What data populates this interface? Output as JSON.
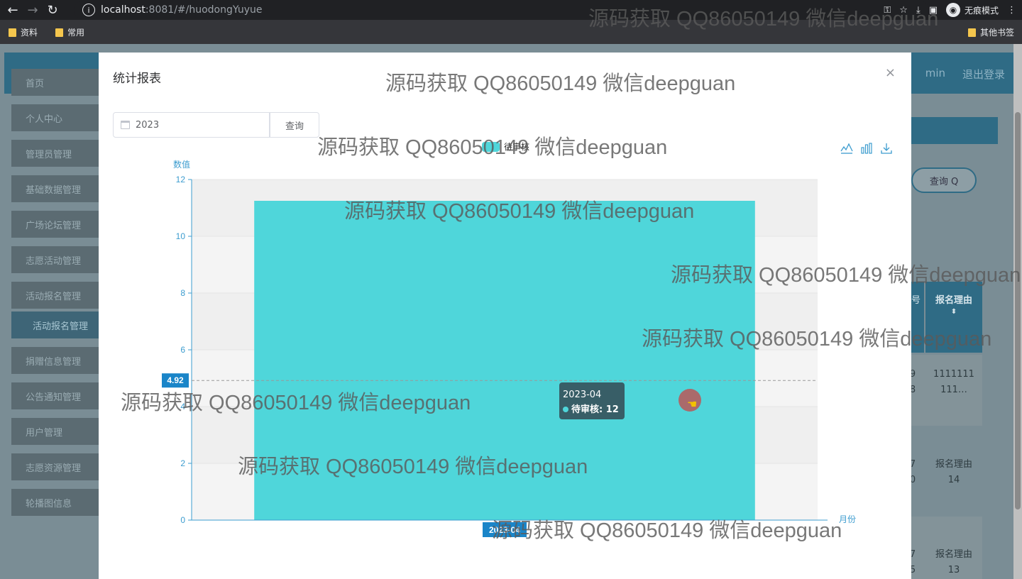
{
  "browser": {
    "url_host": "localhost",
    "url_path": ":8081/#/huodongYuyue",
    "incognito_label": "无痕模式",
    "bookmarks": [
      "资料",
      "常用"
    ],
    "other_bookmarks": "其他书签"
  },
  "app": {
    "header_user": "min",
    "header_logout": "退出登录",
    "sidebar": [
      "首页",
      "个人中心",
      "管理员管理",
      "基础数据管理",
      "广场论坛管理",
      "志愿活动管理",
      "活动报名管理"
    ],
    "sidebar_sub": "活动报名管理",
    "sidebar_rest": [
      "捐赠信息管理",
      "公告通知管理",
      "用户管理",
      "志愿资源管理",
      "轮播图信息"
    ],
    "bg_query_label": "查询 Q",
    "bg_th_left": "号",
    "bg_th": "报名理由",
    "bg_rows": [
      {
        "left": "9\n8",
        "right": "1111111\n111…"
      },
      {
        "left": "7\n0",
        "right": "报名理由\n14"
      },
      {
        "left": "7\n5",
        "right": "报名理由\n13"
      }
    ]
  },
  "modal": {
    "title": "统计报表",
    "close": "×",
    "date_value": "2023",
    "query_label": "查询"
  },
  "chart_data": {
    "type": "bar",
    "categories": [
      "2023-04"
    ],
    "series": [
      {
        "name": "待审核",
        "values": [
          11.25
        ],
        "color": "#4fd6da"
      }
    ],
    "ylabel": "数值",
    "xlabel": "月份",
    "ylim": [
      0,
      12
    ],
    "yticks": [
      0,
      2,
      4,
      6,
      8,
      10,
      12
    ],
    "pointer_y": 4.92,
    "pointer_y_label": "4.92",
    "pointer_x_label": "2023-04",
    "tooltip": {
      "title": "2023-04",
      "series": "待审核",
      "value": "12"
    }
  },
  "watermark": "源码获取 QQ86050149 微信deepguan"
}
